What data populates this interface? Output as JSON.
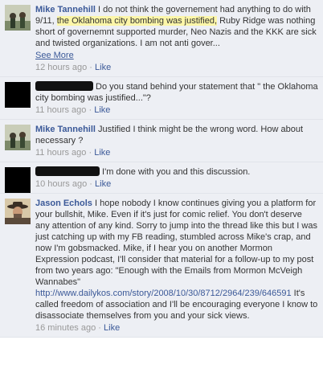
{
  "comments": [
    {
      "author": "Mike Tannehill",
      "text_pre": " I do not think the governement had anything to do with 9/11, ",
      "highlight": "the Oklahoma city bombing was justified,",
      "text_post": " Ruby Ridge was nothing short of governemnt supported murder, Neo Nazis and the KKK are sick and twisted organizations. I am not anti gover...",
      "see_more": "See More",
      "time": "12 hours ago",
      "sep": "·",
      "like": "Like"
    },
    {
      "text": " Do you stand behind your statement that \" the Oklahoma city bombing was justified...\"?",
      "time": "11 hours ago",
      "sep": "·",
      "like": "Like"
    },
    {
      "author": "Mike Tannehill",
      "text": " Justified I think might be the wrong word. How about necessary ?",
      "time": "11 hours ago",
      "sep": "·",
      "like": "Like"
    },
    {
      "text": " I'm done with you and this discussion.",
      "time": "10 hours ago",
      "sep": "·",
      "like": "Like"
    },
    {
      "author": "Jason Echols",
      "text_pre": " I hope nobody I know continues giving you a platform for your bullshit, Mike. Even if it's just for comic relief. You don't deserve any attention of any kind. Sorry to jump into the thread like this but I was just catching up with my FB reading, stumbled across Mike's crap, and now I'm gobsmacked. Mike, if I hear you on another Mormon Expression podcast, I'll consider that material for a follow-up to my post from two years ago: \"Enough with the Emails from Mormon McVeigh Wannabes\" ",
      "link": "http://www.dailykos.com/story/2008/10/30/8712/2964/239/646591",
      "text_post": " It's called freedom of association and I'll be encouraging everyone I know to disassociate themselves from you and your sick views.",
      "time": "16 minutes ago",
      "sep": "·",
      "like": "Like"
    }
  ],
  "colors": {
    "background": "#edeff4",
    "link": "#3b5998",
    "highlight": "#fcf6a8",
    "meta": "#999999"
  }
}
